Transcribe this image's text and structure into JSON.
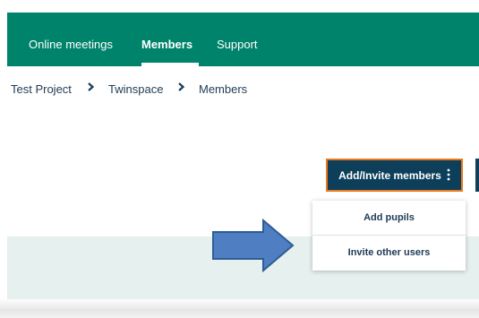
{
  "topnav": {
    "items": [
      {
        "label": "Online meetings"
      },
      {
        "label": "Members",
        "active": true
      },
      {
        "label": "Support"
      }
    ],
    "background": "#00836b"
  },
  "breadcrumb": {
    "items": [
      "Test Project",
      "Twinspace",
      "Members"
    ],
    "separator": "›"
  },
  "add_invite_button": {
    "label": "Add/Invite members",
    "menu_icon": "kebab-icon",
    "background": "#0d3f5a",
    "border_color": "#e8791d"
  },
  "dropdown": {
    "items": [
      {
        "label": "Add pupils"
      },
      {
        "label": "Invite other users"
      }
    ]
  },
  "annotation": {
    "icon": "arrow-right-icon",
    "color": "#4f7fc2"
  }
}
